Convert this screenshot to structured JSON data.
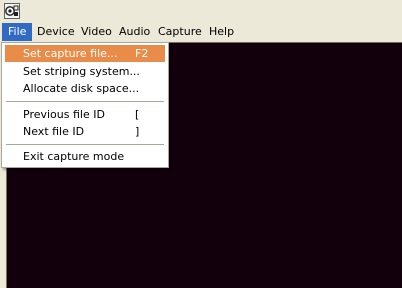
{
  "menubar": {
    "items": [
      {
        "label": "File"
      },
      {
        "label": "Device"
      },
      {
        "label": "Video"
      },
      {
        "label": "Audio"
      },
      {
        "label": "Capture"
      },
      {
        "label": "Help"
      }
    ]
  },
  "file_menu": {
    "items": [
      {
        "label": "Set capture file...",
        "shortcut": "F2"
      },
      {
        "label": "Set striping system...",
        "shortcut": ""
      },
      {
        "label": "Allocate disk space...",
        "shortcut": ""
      },
      {
        "label": "Previous file ID",
        "shortcut": "["
      },
      {
        "label": "Next file ID",
        "shortcut": "]"
      },
      {
        "label": "Exit capture mode",
        "shortcut": ""
      }
    ]
  },
  "colors": {
    "menu_highlight": "#e98c4a",
    "menubar_active": "#316ac5",
    "capture_area": "#12000d",
    "chrome": "#ece9d8"
  },
  "icons": {
    "app": "capture-app-icon"
  }
}
